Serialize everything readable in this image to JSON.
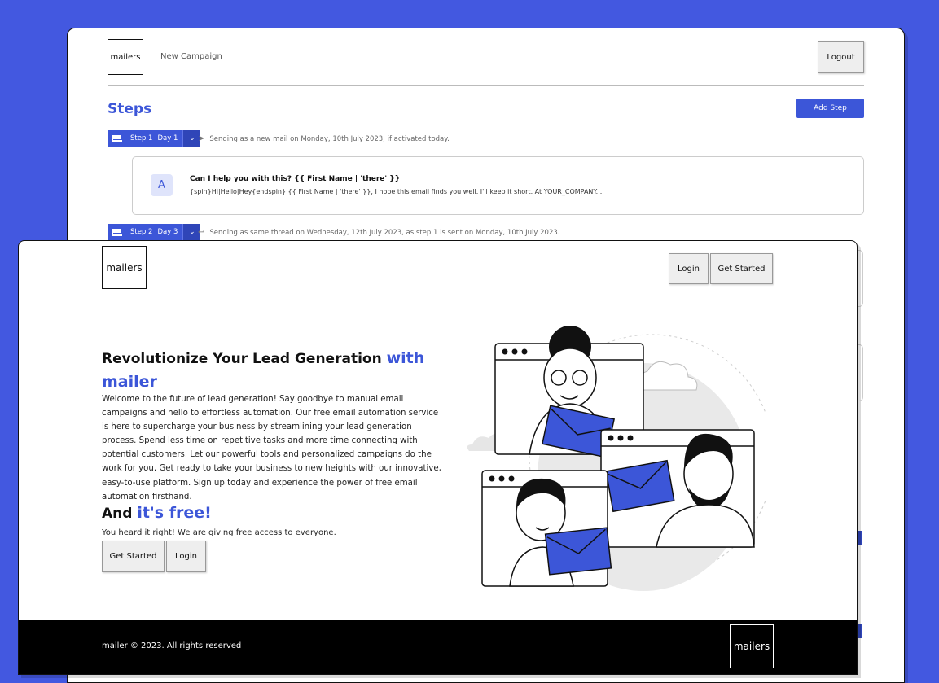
{
  "colors": {
    "accent": "#3c56d8",
    "background": "#4358e0"
  },
  "back_window": {
    "logo": "mailers",
    "breadcrumb": "New Campaign",
    "logout_label": "Logout",
    "steps_title": "Steps",
    "add_step_label": "Add Step",
    "steps": [
      {
        "label": "Step 1",
        "day": "Day 1",
        "note": "Sending as a new mail on Monday, 10th July 2023, if activated today.",
        "icon": "send-icon"
      },
      {
        "label": "Step 2",
        "day": "Day 3",
        "note": "Sending as same thread on Wednesday, 12th July 2023, as step 1 is sent on Monday, 10th July 2023.",
        "icon": "reply-icon"
      }
    ],
    "mail": {
      "avatar": "A",
      "subject": "Can I help you with this? {{ First Name | 'there' }}",
      "preview": "{spin}Hi|Hello|Hey{endspin} {{ First Name | 'there' }}, I hope this email finds you well. I'll keep it short. At YOUR_COMPANY..."
    }
  },
  "front_window": {
    "logo": "mailers",
    "nav": {
      "login_label": "Login",
      "get_started_label": "Get Started"
    },
    "hero": {
      "title_plain": "Revolutionize Your Lead Generation ",
      "title_accent": "with mailer",
      "text": "Welcome to the future of lead generation! Say goodbye to manual email campaigns and hello to effortless automation. Our free email automation service is here to supercharge your business by streamlining your lead generation process. Spend less time on repetitive tasks and more time connecting with potential customers. Let our powerful tools and personalized campaigns do the work for you. Get ready to take your business to new heights with our innovative, easy-to-use platform. Sign up today and experience the power of free email automation firsthand.",
      "free_plain": "And ",
      "free_accent": "it's free!",
      "free_sub": "You heard it right! We are giving free access to everyone.",
      "cta_get_started": "Get Started",
      "cta_login": "Login"
    },
    "footer": {
      "copyright": "mailer © 2023. All rights reserved",
      "logo": "mailers"
    }
  }
}
